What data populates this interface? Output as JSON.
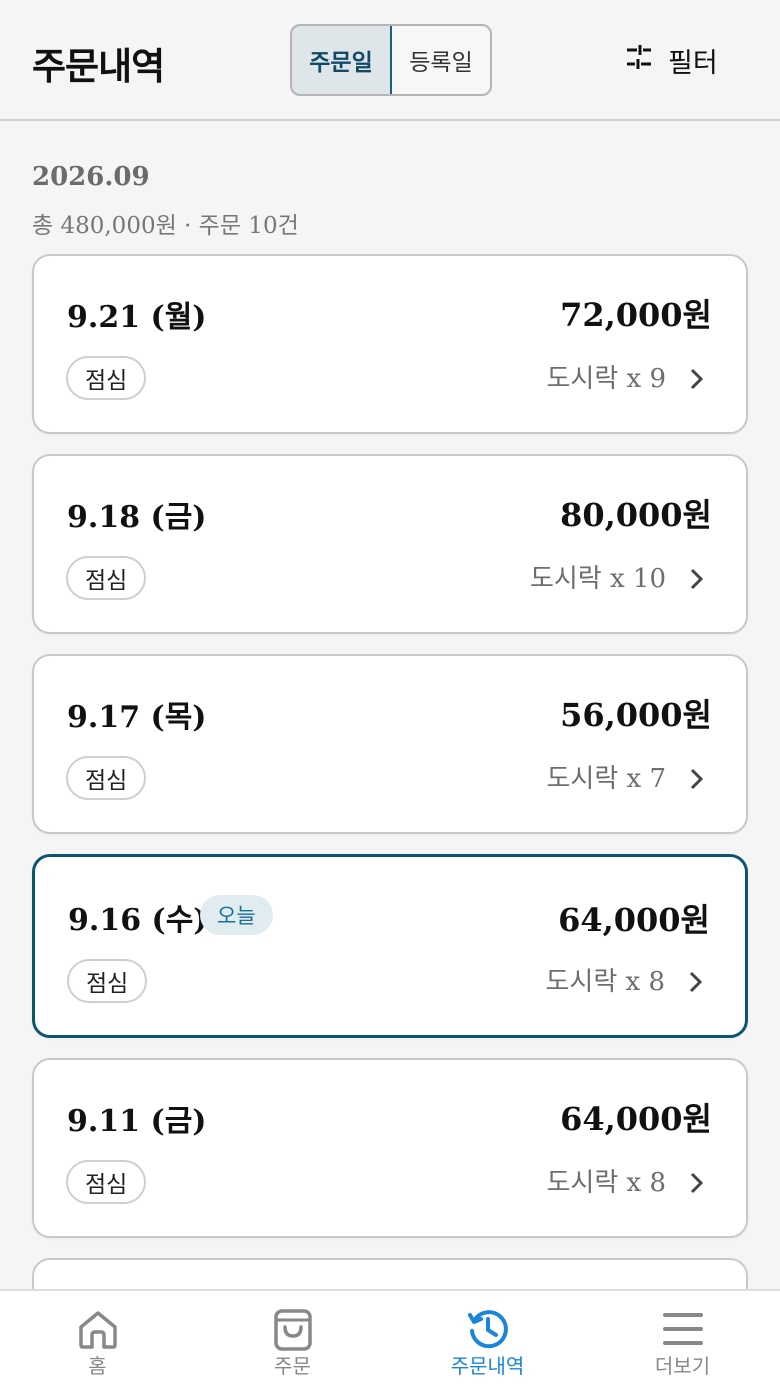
{
  "header": {
    "title": "주문내역",
    "segment": {
      "options": [
        "주문일",
        "등록일"
      ],
      "selected": "주문일"
    },
    "filter_label": "필터",
    "filter_icon": "sliders-icon"
  },
  "month": {
    "label": "2026.09",
    "summary": "총 480,000원 · 주문 10건"
  },
  "orders": [
    {
      "date": "9.21 (월)",
      "amount": "72,000원",
      "meal": "점심",
      "items": "도시락 x 9",
      "today": false,
      "badge": ""
    },
    {
      "date": "9.18 (금)",
      "amount": "80,000원",
      "meal": "점심",
      "items": "도시락 x 10",
      "today": false,
      "badge": ""
    },
    {
      "date": "9.17 (목)",
      "amount": "56,000원",
      "meal": "점심",
      "items": "도시락 x 7",
      "today": false,
      "badge": ""
    },
    {
      "date": "9.16 (수)",
      "amount": "64,000원",
      "meal": "점심",
      "items": "도시락 x 8",
      "today": true,
      "badge": "오늘"
    },
    {
      "date": "9.11 (금)",
      "amount": "64,000원",
      "meal": "점심",
      "items": "도시락 x 8",
      "today": false,
      "badge": ""
    }
  ],
  "tabbar": {
    "items": [
      {
        "label": "홈",
        "icon": "home-icon",
        "active": false
      },
      {
        "label": "주문",
        "icon": "shopping-bag-icon",
        "active": false
      },
      {
        "label": "주문내역",
        "icon": "history-icon",
        "active": true
      },
      {
        "label": "더보기",
        "icon": "menu-icon",
        "active": false
      }
    ]
  },
  "colors": {
    "accent": "#0b5573",
    "tab_active": "#1a86d8",
    "badge_bg": "#e1ecf1"
  }
}
